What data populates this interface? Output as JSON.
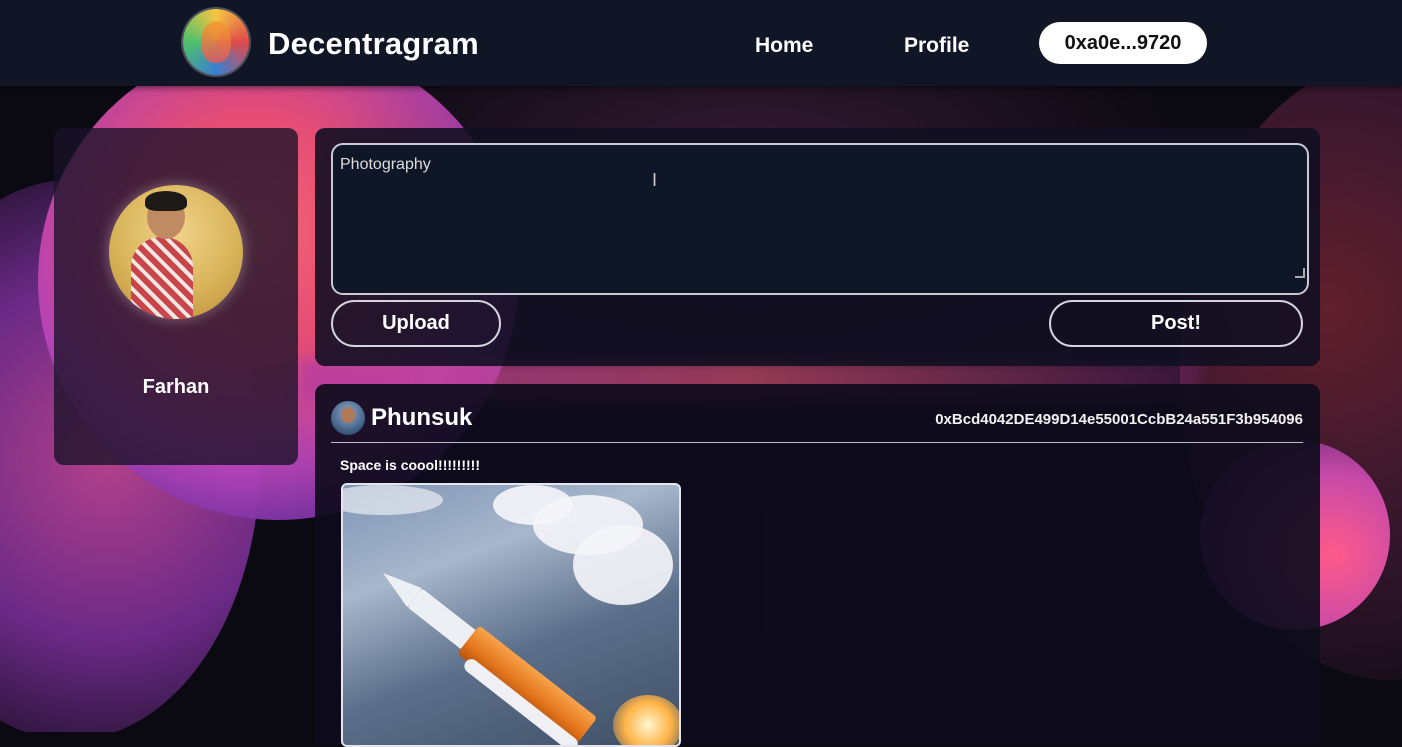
{
  "app": {
    "name": "Decentragram"
  },
  "nav": {
    "home": "Home",
    "profile": "Profile",
    "wallet": "0xa0e...9720"
  },
  "profile": {
    "name": "Farhan"
  },
  "composer": {
    "caption_value": "",
    "caption_placeholder": "Photography",
    "upload_label": "Upload",
    "post_label": "Post!"
  },
  "posts": [
    {
      "author": "Phunsuk",
      "address": "0xBcd4042DE499D14e55001CcbB24a551F3b954096",
      "text": "Space is coool!!!!!!!!!"
    }
  ],
  "colors": {
    "navbar": "#111627",
    "background": "#0b0a12",
    "accent_pink": "#f0507a",
    "accent_purple": "#b744b8"
  }
}
